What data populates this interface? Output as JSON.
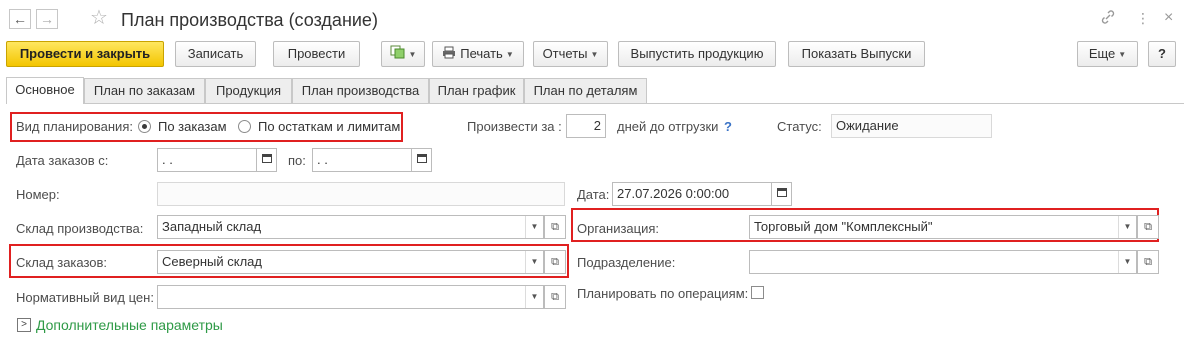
{
  "window": {
    "title": "План производства (создание)",
    "nav_back": "←",
    "nav_forward": "→",
    "star": "☆",
    "link_icon": "🔗",
    "more_icon": "⋮",
    "close_icon": "×"
  },
  "toolbar": {
    "post_close": "Провести и закрыть",
    "save": "Записать",
    "post": "Провести",
    "print": "Печать",
    "reports": "Отчеты",
    "release": "Выпустить продукцию",
    "show_releases": "Показать Выпуски",
    "more": "Еще",
    "help": "?"
  },
  "tabs": [
    "Основное",
    "План по заказам",
    "Продукция",
    "План производства",
    "План график",
    "План по деталям"
  ],
  "form": {
    "planning_type_label": "Вид планирования:",
    "planning_opt1": "По заказам",
    "planning_opt2": "По остаткам и лимитам",
    "produce_for_label": "Произвести за :",
    "produce_for_value": "2",
    "days_label": "дней до отгрузки",
    "help_q": "?",
    "status_label": "Статус:",
    "status_value": "Ожидание",
    "orders_date_from_label": "Дата заказов с:",
    "orders_date_from_value": " .  .",
    "to_label": "по:",
    "orders_date_to_value": " .  .",
    "number_label": "Номер:",
    "number_value": "",
    "date_label": "Дата:",
    "date_value": "27.07.2026  0:00:00",
    "prod_warehouse_label": "Склад производства:",
    "prod_warehouse_value": "Западный склад",
    "organization_label": "Организация:",
    "organization_value": "Торговый дом \"Комплексный\"",
    "orders_warehouse_label": "Склад заказов:",
    "orders_warehouse_value": "Северный склад",
    "department_label": "Подразделение:",
    "department_value": "",
    "price_type_label": "Нормативный вид цен:",
    "price_type_value": "",
    "plan_by_ops_label": "Планировать по операциям:",
    "additional_params": "Дополнительные параметры"
  },
  "colors": {
    "highlight": "#e02020",
    "primary_button": "#f5cd16",
    "link_green": "#2e9a46",
    "help_blue": "#3a73c6"
  }
}
